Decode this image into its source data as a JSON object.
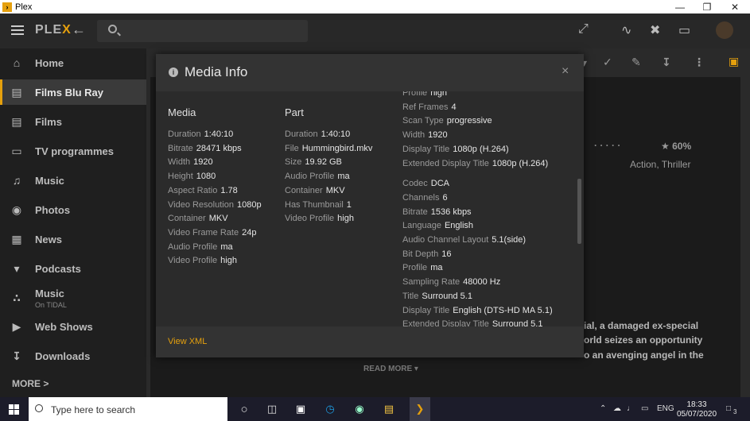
{
  "window": {
    "title": "Plex"
  },
  "header": {
    "logo_main": "PLE",
    "logo_accent": "X"
  },
  "sidebar": {
    "items": [
      {
        "label": "Home",
        "icon": "home-icon"
      },
      {
        "label": "Films Blu Ray",
        "icon": "film-icon",
        "active": true
      },
      {
        "label": "Films",
        "icon": "film-icon"
      },
      {
        "label": "TV programmes",
        "icon": "tv-icon"
      },
      {
        "label": "Music",
        "icon": "music-note-icon"
      },
      {
        "label": "Photos",
        "icon": "camera-icon"
      },
      {
        "label": "News",
        "icon": "news-icon"
      },
      {
        "label": "Podcasts",
        "icon": "microphone-icon"
      },
      {
        "label": "Music",
        "sublabel": "On TIDAL",
        "icon": "tidal-icon"
      },
      {
        "label": "Web Shows",
        "icon": "play-icon"
      },
      {
        "label": "Downloads",
        "icon": "download-icon"
      }
    ],
    "more": "MORE >"
  },
  "background": {
    "rating": "★ 60%",
    "genres": "Action, Thriller",
    "summary_lines": [
      "ial, a damaged ex-special",
      "orld seizes an opportunity",
      "o an avenging angel in the"
    ],
    "read_more": "READ MORE ▾"
  },
  "modal": {
    "title": "Media Info",
    "close": "×",
    "media": {
      "heading": "Media",
      "rows": [
        {
          "k": "Duration",
          "v": "1:40:10"
        },
        {
          "k": "Bitrate",
          "v": "28471 kbps"
        },
        {
          "k": "Width",
          "v": "1920"
        },
        {
          "k": "Height",
          "v": "1080"
        },
        {
          "k": "Aspect Ratio",
          "v": "1.78"
        },
        {
          "k": "Video Resolution",
          "v": "1080p"
        },
        {
          "k": "Container",
          "v": "MKV"
        },
        {
          "k": "Video Frame Rate",
          "v": "24p"
        },
        {
          "k": "Audio Profile",
          "v": "ma"
        },
        {
          "k": "Video Profile",
          "v": "high"
        }
      ]
    },
    "part": {
      "heading": "Part",
      "rows": [
        {
          "k": "Duration",
          "v": "1:40:10"
        },
        {
          "k": "File",
          "v": "Hummingbird.mkv"
        },
        {
          "k": "Size",
          "v": "19.92 GB"
        },
        {
          "k": "Audio Profile",
          "v": "ma"
        },
        {
          "k": "Container",
          "v": "MKV"
        },
        {
          "k": "Has Thumbnail",
          "v": "1"
        },
        {
          "k": "Video Profile",
          "v": "high"
        }
      ]
    },
    "video_stream": {
      "rows": [
        {
          "k": "Profile",
          "v": "high"
        },
        {
          "k": "Ref Frames",
          "v": "4"
        },
        {
          "k": "Scan Type",
          "v": "progressive"
        },
        {
          "k": "Width",
          "v": "1920"
        },
        {
          "k": "Display Title",
          "v": "1080p (H.264)"
        },
        {
          "k": "Extended Display Title",
          "v": "1080p (H.264)"
        }
      ]
    },
    "audio_stream": {
      "rows": [
        {
          "k": "Codec",
          "v": "DCA"
        },
        {
          "k": "Channels",
          "v": "6"
        },
        {
          "k": "Bitrate",
          "v": "1536 kbps"
        },
        {
          "k": "Language",
          "v": "English"
        },
        {
          "k": "Audio Channel Layout",
          "v": "5.1(side)"
        },
        {
          "k": "Bit Depth",
          "v": "16"
        },
        {
          "k": "Profile",
          "v": "ma"
        },
        {
          "k": "Sampling Rate",
          "v": "48000 Hz"
        },
        {
          "k": "Title",
          "v": "Surround 5.1"
        },
        {
          "k": "Display Title",
          "v": "English (DTS-HD MA 5.1)"
        },
        {
          "k": "Extended Display Title",
          "v": "Surround 5.1"
        }
      ]
    },
    "footer_link": "View XML"
  },
  "taskbar": {
    "search_placeholder": "Type here to search",
    "language": "ENG",
    "time": "18:33",
    "date": "05/07/2020",
    "notifications": "3"
  },
  "colors": {
    "accent": "#e5a00d",
    "modal_bg": "#2b2b2b"
  }
}
